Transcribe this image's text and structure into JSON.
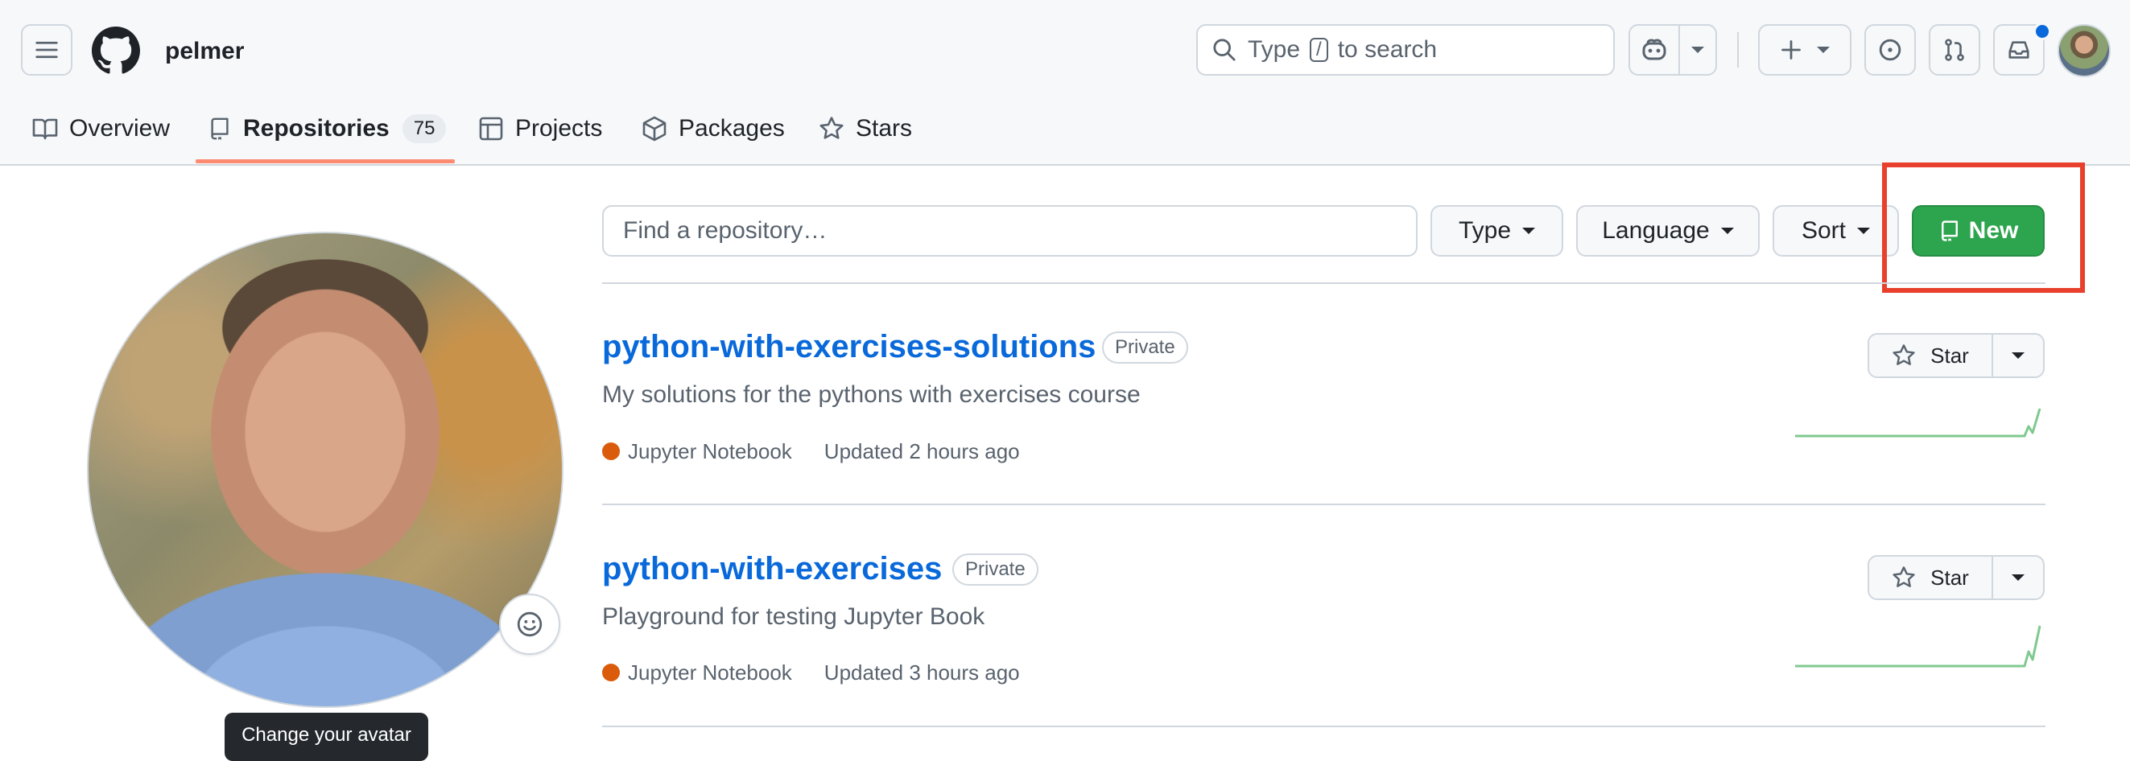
{
  "header": {
    "username": "pelmer",
    "search_prefix": "Type",
    "search_key": "/",
    "search_suffix": "to search"
  },
  "tabs": [
    {
      "label": "Overview"
    },
    {
      "label": "Repositories",
      "count": "75"
    },
    {
      "label": "Projects"
    },
    {
      "label": "Packages"
    },
    {
      "label": "Stars"
    }
  ],
  "filters": {
    "search_placeholder": "Find a repository…",
    "type_label": "Type",
    "language_label": "Language",
    "sort_label": "Sort",
    "new_label": "New"
  },
  "profile": {
    "tooltip": "Change your avatar"
  },
  "repos": [
    {
      "name": "python-with-exercises-solutions",
      "visibility": "Private",
      "description": "My solutions for the pythons with exercises course",
      "language": "Jupyter Notebook",
      "updated": "Updated 2 hours ago",
      "star_label": "Star"
    },
    {
      "name": "python-with-exercises",
      "visibility": "Private",
      "description": "Playground for testing Jupyter Book",
      "language": "Jupyter Notebook",
      "updated": "Updated 3 hours ago",
      "star_label": "Star"
    }
  ],
  "colors": {
    "primary_button": "#2da44e",
    "link": "#0969da",
    "active_tab_underline": "#fd8c73",
    "language_jupyter": "#da5b0b",
    "highlight_box": "#e8402c"
  }
}
